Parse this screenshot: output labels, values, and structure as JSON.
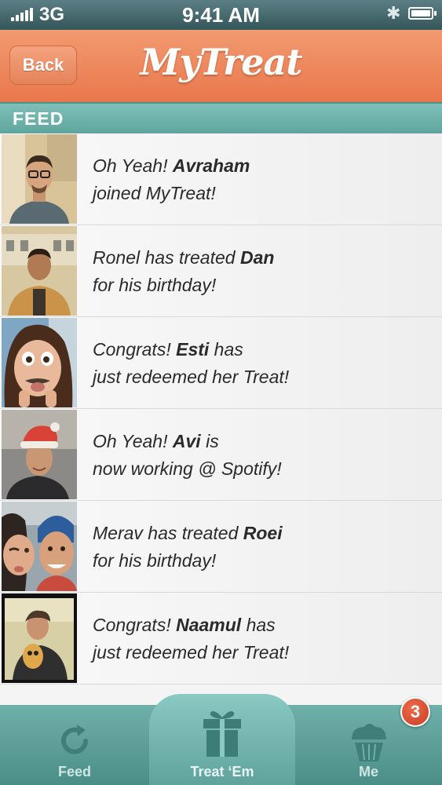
{
  "status_bar": {
    "carrier": "3G",
    "time": "9:41 AM",
    "signal_icon": "signal-bars-icon",
    "bluetooth_icon": "bluetooth-icon",
    "battery_icon": "battery-icon"
  },
  "nav": {
    "back_label": "Back",
    "title": "MyTreat"
  },
  "section": {
    "label": "FEED"
  },
  "feed": [
    {
      "pre": "Oh Yeah! ",
      "name": "Avraham",
      "post": "",
      "line2": "joined MyTreat!"
    },
    {
      "pre": "Ronel has treated ",
      "name": "Dan",
      "post": "",
      "line2": "for his birthday!"
    },
    {
      "pre": "Congrats! ",
      "name": "Esti",
      "post": " has",
      "line2": "just redeemed her Treat!"
    },
    {
      "pre": "Oh Yeah! ",
      "name": "Avi",
      "post": " is",
      "line2": "now working @ Spotify!"
    },
    {
      "pre": "Merav has treated ",
      "name": "Roei",
      "post": "",
      "line2": "for his birthday!"
    },
    {
      "pre": "Congrats! ",
      "name": "Naamul",
      "post": " has",
      "line2": "just redeemed her Treat!"
    }
  ],
  "tabs": {
    "feed": "Feed",
    "treat": "Treat ‘Em",
    "me": "Me"
  },
  "badge": {
    "count": "3"
  },
  "colors": {
    "nav": "#e9774c",
    "teal": "#5fa59e",
    "badge": "#d44a2e"
  }
}
